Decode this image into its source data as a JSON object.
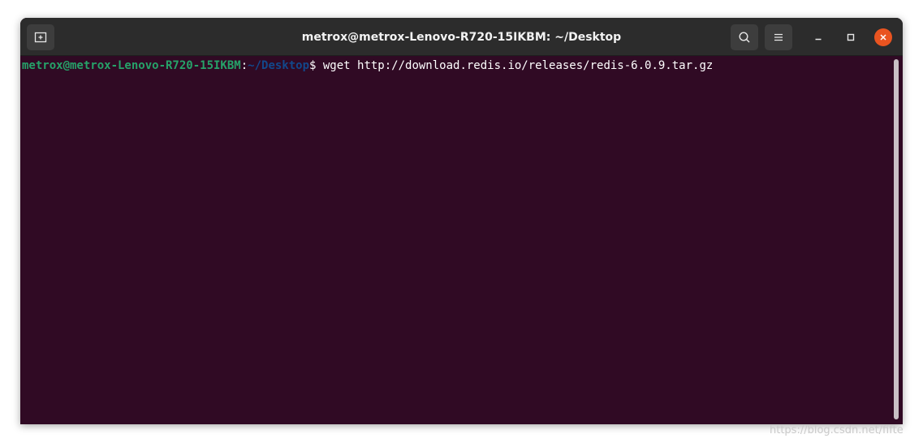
{
  "window": {
    "title": "metrox@metrox-Lenovo-R720-15IKBM: ~/Desktop"
  },
  "icons": {
    "new_tab": "new-tab-icon",
    "search": "search-icon",
    "menu": "hamburger-menu-icon",
    "minimize": "minimize-icon",
    "maximize": "maximize-icon",
    "close": "close-icon"
  },
  "terminal": {
    "prompt_user": "metrox@metrox-Lenovo-R720-15IKBM",
    "prompt_colon": ":",
    "prompt_path": "~/Desktop",
    "prompt_symbol": "$ ",
    "command": "wget http://download.redis.io/releases/redis-6.0.9.tar.gz"
  },
  "colors": {
    "terminal_bg": "#300a24",
    "prompt_user": "#26a269",
    "prompt_path": "#12488b",
    "close_button": "#e95420",
    "titlebar": "#2c2c2c"
  },
  "watermark": "https://blog.csdn.net/fifte"
}
